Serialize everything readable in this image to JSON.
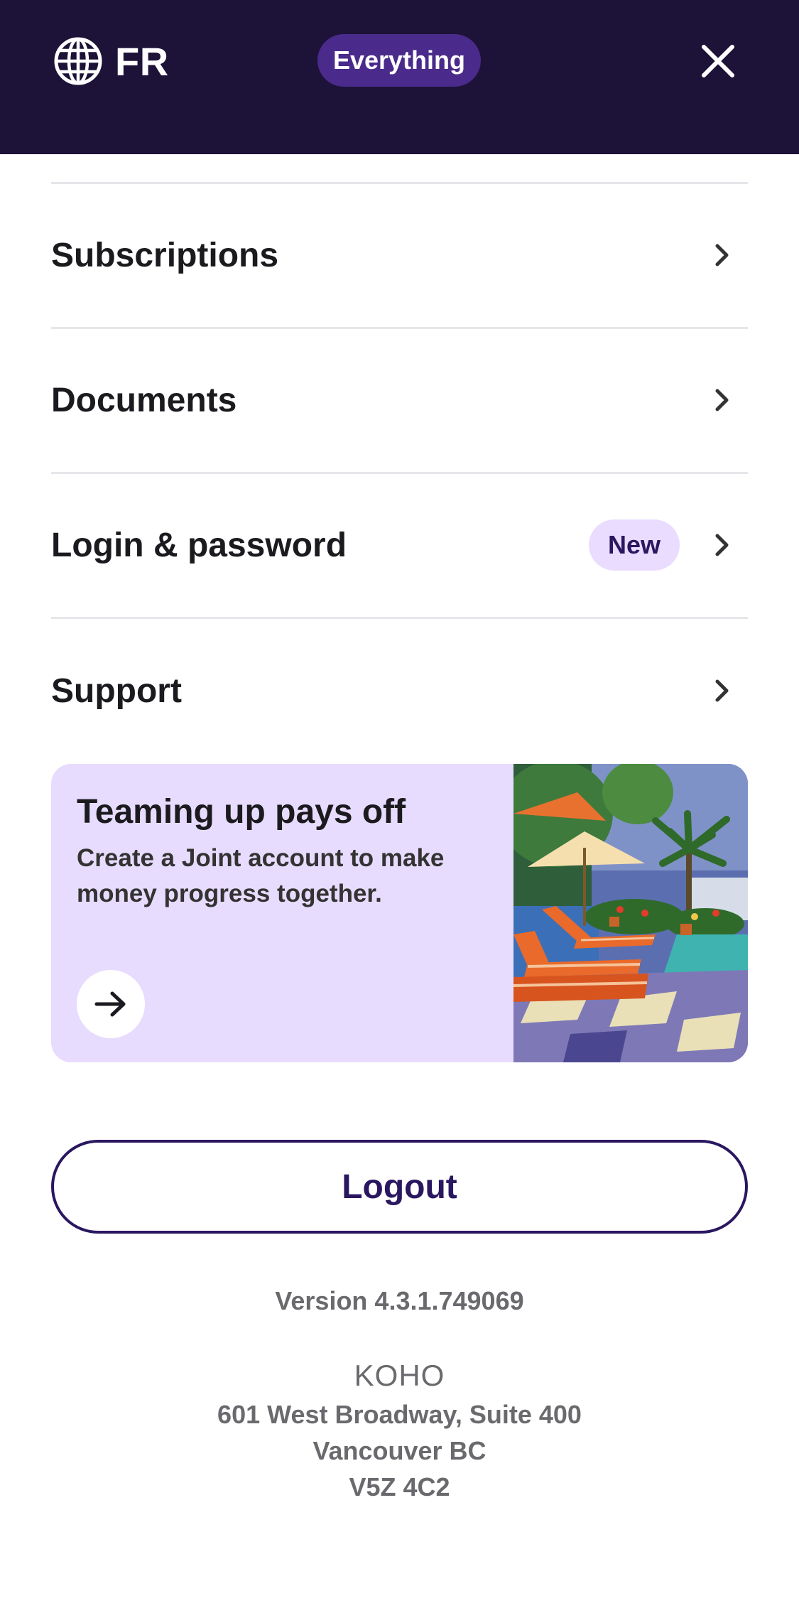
{
  "header": {
    "language_label": "FR",
    "filter_pill": "Everything",
    "background": "#1d1238"
  },
  "menu": {
    "items": [
      {
        "label": "Subscriptions"
      },
      {
        "label": "Documents"
      },
      {
        "label": "Login & password",
        "badge": "New"
      },
      {
        "label": "Support"
      }
    ]
  },
  "promo": {
    "title": "Teaming up pays off",
    "body": "Create a Joint account to make money progress together.",
    "background": "#e8dcfe"
  },
  "logout_label": "Logout",
  "version": "Version 4.3.1.749069",
  "footer": {
    "company": "KOHO",
    "address_line1": "601 West Broadway, Suite 400",
    "address_line2": "Vancouver BC",
    "address_line3": "V5Z 4C2"
  },
  "colors": {
    "accent": "#2a1760",
    "badge_bg": "#eadcff"
  }
}
